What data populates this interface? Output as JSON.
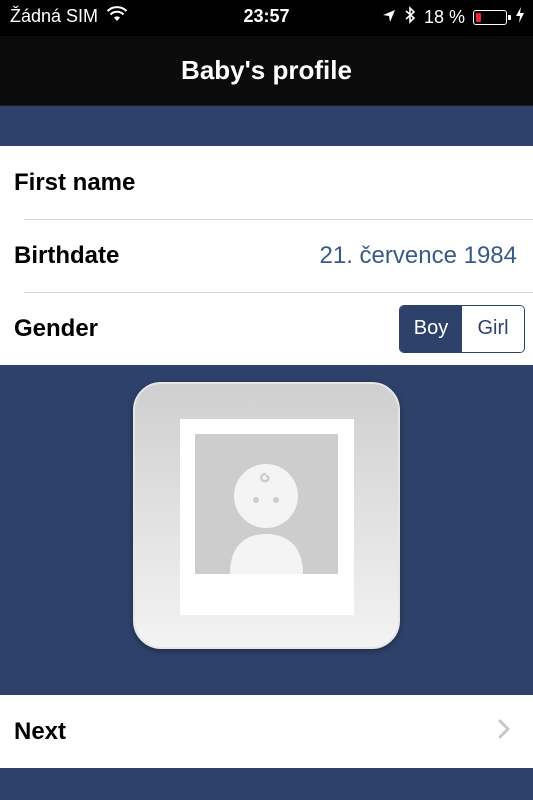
{
  "status_bar": {
    "carrier": "Žádná SIM",
    "time": "23:57",
    "battery_percent": "18 %",
    "battery_level": 0.18,
    "icons": [
      "wifi-icon",
      "location-icon",
      "bluetooth-icon",
      "battery-icon",
      "charging-icon"
    ]
  },
  "nav": {
    "title": "Baby's profile"
  },
  "profile": {
    "first_name_label": "First name",
    "first_name_value": "",
    "birthdate_label": "Birthdate",
    "birthdate_value": "21. července 1984",
    "gender_label": "Gender",
    "gender_options": [
      "Boy",
      "Girl"
    ],
    "gender_selected": "Boy"
  },
  "photo": {
    "icon": "baby-photo-placeholder-icon"
  },
  "footer": {
    "next_label": "Next",
    "next_icon": "chevron-right-icon"
  },
  "colors": {
    "accent": "#2e416a",
    "value_text": "#3a5a86",
    "battery_low": "#e8283a"
  }
}
